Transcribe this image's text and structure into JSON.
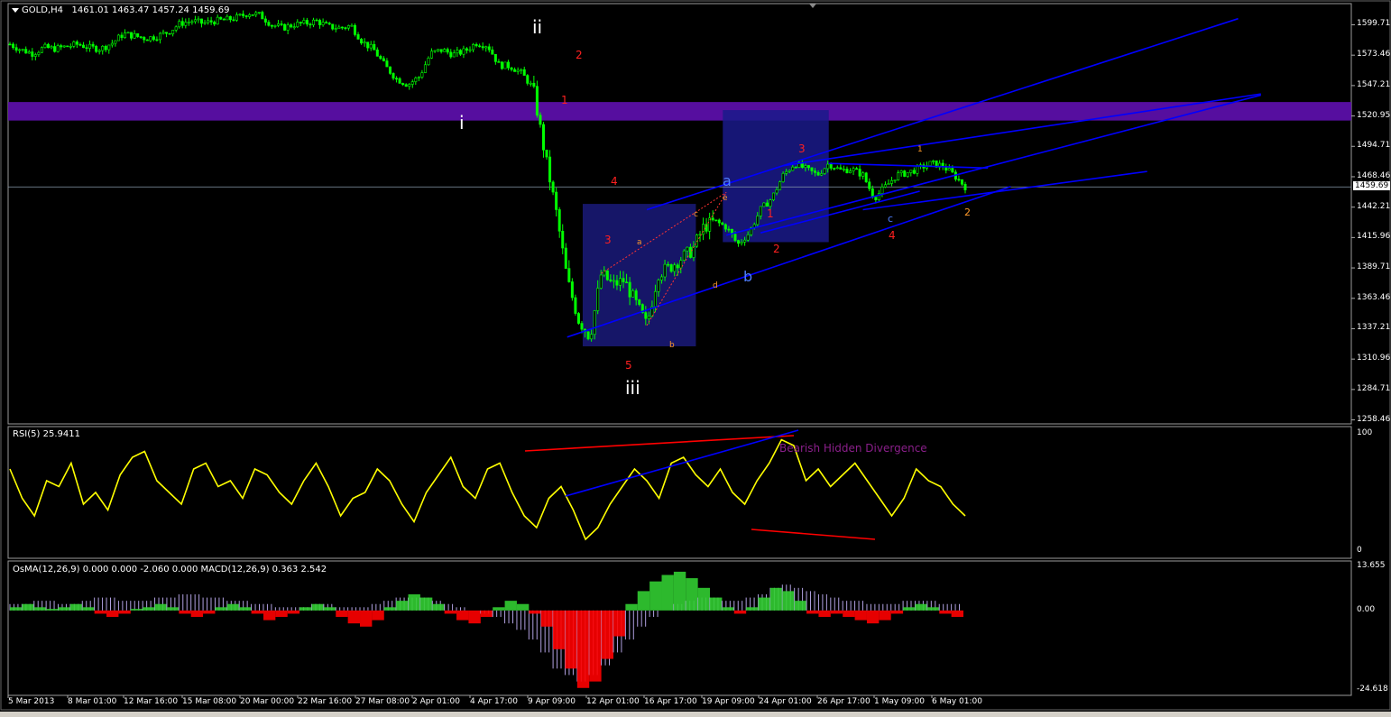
{
  "header": {
    "symbol": "GOLD,H4",
    "ohlc": "1461.01 1463.47 1457.24 1459.69"
  },
  "colors": {
    "candle_up": "#00ff00",
    "candle_down": "#00ff00",
    "rsi_line": "#ffff00",
    "zone": "#5b0fa8",
    "trend_lines": "#0000ff",
    "divergence": "#ff0000",
    "osma_pos": "#32cd32",
    "osma_neg": "#ff0000",
    "macd_bars": "#b0a0e0"
  },
  "chart_data": [
    {
      "type": "candlestick",
      "title": "GOLD,H4",
      "current_price": "1459.69",
      "ylim": [
        1255,
        1618
      ],
      "y_ticks": [
        "1599.71",
        "1573.46",
        "1547.21",
        "1520.95",
        "1494.71",
        "1468.46",
        "1442.21",
        "1415.96",
        "1389.71",
        "1363.46",
        "1337.21",
        "1310.96",
        "1284.71",
        "1258.46"
      ],
      "x_ticks": [
        "5 Mar 2013",
        "8 Mar 01:00",
        "12 Mar 16:00",
        "15 Mar 08:00",
        "20 Mar 00:00",
        "22 Mar 16:00",
        "27 Mar 08:00",
        "2 Apr 01:00",
        "4 Apr 17:00",
        "9 Apr 09:00",
        "12 Apr 01:00",
        "16 Apr 17:00",
        "19 Apr 09:00",
        "24 Apr 01:00",
        "26 Apr 17:00",
        "1 May 09:00",
        "6 May 01:00"
      ],
      "close_path": [
        [
          0,
          1583
        ],
        [
          0.01,
          1578
        ],
        [
          0.02,
          1575
        ],
        [
          0.03,
          1580
        ],
        [
          0.04,
          1579
        ],
        [
          0.05,
          1581
        ],
        [
          0.06,
          1583
        ],
        [
          0.07,
          1580
        ],
        [
          0.08,
          1579
        ],
        [
          0.09,
          1584
        ],
        [
          0.1,
          1592
        ],
        [
          0.11,
          1590
        ],
        [
          0.12,
          1588
        ],
        [
          0.13,
          1590
        ],
        [
          0.14,
          1594
        ],
        [
          0.15,
          1601
        ],
        [
          0.16,
          1603
        ],
        [
          0.17,
          1601
        ],
        [
          0.18,
          1603
        ],
        [
          0.19,
          1604
        ],
        [
          0.2,
          1606
        ],
        [
          0.21,
          1610
        ],
        [
          0.22,
          1608
        ],
        [
          0.23,
          1600
        ],
        [
          0.24,
          1597
        ],
        [
          0.25,
          1600
        ],
        [
          0.26,
          1601
        ],
        [
          0.27,
          1603
        ],
        [
          0.28,
          1598
        ],
        [
          0.29,
          1597
        ],
        [
          0.3,
          1599
        ],
        [
          0.31,
          1585
        ],
        [
          0.32,
          1578
        ],
        [
          0.33,
          1564
        ],
        [
          0.34,
          1553
        ],
        [
          0.35,
          1548
        ],
        [
          0.36,
          1555
        ],
        [
          0.37,
          1575
        ],
        [
          0.38,
          1578
        ],
        [
          0.39,
          1574
        ],
        [
          0.4,
          1577
        ],
        [
          0.41,
          1584
        ],
        [
          0.42,
          1582
        ],
        [
          0.43,
          1565
        ],
        [
          0.44,
          1564
        ],
        [
          0.45,
          1558
        ],
        [
          0.46,
          1545
        ],
        [
          0.47,
          1490
        ],
        [
          0.48,
          1440
        ],
        [
          0.49,
          1380
        ],
        [
          0.5,
          1345
        ],
        [
          0.51,
          1330
        ],
        [
          0.52,
          1385
        ],
        [
          0.53,
          1375
        ],
        [
          0.54,
          1379
        ],
        [
          0.55,
          1360
        ],
        [
          0.56,
          1340
        ],
        [
          0.57,
          1385
        ],
        [
          0.58,
          1390
        ],
        [
          0.59,
          1398
        ],
        [
          0.6,
          1405
        ],
        [
          0.61,
          1425
        ],
        [
          0.62,
          1430
        ],
        [
          0.63,
          1425
        ],
        [
          0.64,
          1410
        ],
        [
          0.65,
          1420
        ],
        [
          0.66,
          1440
        ],
        [
          0.67,
          1450
        ],
        [
          0.68,
          1470
        ],
        [
          0.69,
          1480
        ],
        [
          0.7,
          1475
        ],
        [
          0.71,
          1470
        ],
        [
          0.72,
          1480
        ],
        [
          0.73,
          1474
        ],
        [
          0.74,
          1475
        ],
        [
          0.75,
          1470
        ],
        [
          0.76,
          1450
        ],
        [
          0.77,
          1460
        ],
        [
          0.78,
          1470
        ],
        [
          0.79,
          1472
        ],
        [
          0.8,
          1476
        ],
        [
          0.81,
          1480
        ],
        [
          0.82,
          1478
        ],
        [
          0.83,
          1470
        ],
        [
          0.84,
          1460
        ]
      ]
    },
    {
      "type": "line",
      "title": "RSI(5) 25.9411",
      "ylim": [
        0,
        100
      ],
      "y_ticks": [
        "100",
        "0"
      ],
      "annotation": "Bearish Hidden Divergence",
      "values": [
        70,
        45,
        30,
        60,
        55,
        75,
        40,
        50,
        35,
        65,
        80,
        85,
        60,
        50,
        40,
        70,
        75,
        55,
        60,
        45,
        70,
        65,
        50,
        40,
        60,
        75,
        55,
        30,
        45,
        50,
        70,
        60,
        40,
        25,
        50,
        65,
        80,
        55,
        45,
        70,
        75,
        50,
        30,
        20,
        45,
        55,
        35,
        10,
        20,
        40,
        55,
        70,
        60,
        45,
        75,
        80,
        65,
        55,
        70,
        50,
        40,
        60,
        75,
        95,
        90,
        60,
        70,
        55,
        65,
        75,
        60,
        45,
        30,
        45,
        70,
        60,
        55,
        40,
        30
      ]
    },
    {
      "type": "bar",
      "title": "OsMA(12,26,9) 0.000 0.000 -2.060 0.000  MACD(12,26,9) 0.363 2.542",
      "ylim": [
        -24.618,
        13.655
      ],
      "y_ticks": [
        "13.655",
        "0.00",
        "-24.618"
      ],
      "osma": [
        1,
        2,
        1,
        0.5,
        1,
        2,
        1,
        -1,
        -2,
        -1,
        0.5,
        1,
        2,
        1,
        -1,
        -2,
        -1,
        1,
        2,
        1,
        -1,
        -3,
        -2,
        -1,
        1,
        2,
        1,
        -2,
        -4,
        -5,
        -3,
        1,
        3,
        5,
        4,
        2,
        -1,
        -3,
        -4,
        -2,
        1,
        3,
        2,
        -1,
        -5,
        -12,
        -18,
        -24,
        -22,
        -15,
        -8,
        2,
        6,
        9,
        11,
        12,
        10,
        7,
        4,
        1,
        -1,
        1,
        4,
        7,
        6,
        3,
        -1,
        -2,
        -1,
        -2,
        -3,
        -4,
        -3,
        -1,
        1,
        2,
        1,
        -1,
        -2
      ],
      "macd": [
        2,
        2,
        3,
        3,
        2,
        2,
        3,
        4,
        4,
        3,
        3,
        3,
        4,
        4,
        5,
        5,
        4,
        4,
        3,
        3,
        2,
        2,
        1,
        1,
        1,
        2,
        2,
        1,
        1,
        1,
        2,
        3,
        4,
        4,
        4,
        3,
        2,
        1,
        0,
        -1,
        -2,
        -4,
        -6,
        -9,
        -13,
        -18,
        -20,
        -22,
        -20,
        -17,
        -13,
        -9,
        -5,
        -2,
        0,
        2,
        3,
        4,
        4,
        3,
        3,
        4,
        5,
        7,
        8,
        7,
        6,
        5,
        4,
        3,
        3,
        2,
        2,
        2,
        3,
        3,
        3,
        2,
        2
      ]
    }
  ],
  "wave_labels": [
    {
      "text": "ii",
      "color": "#ffffff"
    },
    {
      "text": "i",
      "color": "#ffffff"
    },
    {
      "text": "iii",
      "color": "#ffffff"
    },
    {
      "text": "2",
      "color": "#ff2020"
    },
    {
      "text": "1",
      "color": "#ff2020"
    },
    {
      "text": "4",
      "color": "#ff2020"
    },
    {
      "text": "3",
      "color": "#ff2020"
    },
    {
      "text": "5",
      "color": "#ff2020"
    },
    {
      "text": "a",
      "color": "#4f7fff"
    },
    {
      "text": "b",
      "color": "#4f7fff"
    },
    {
      "text": "3",
      "color": "#ff2020"
    },
    {
      "text": "1",
      "color": "#ff2020"
    },
    {
      "text": "2",
      "color": "#ff2020"
    },
    {
      "text": "4",
      "color": "#ff2020"
    },
    {
      "text": "1",
      "color": "#ff9a2a"
    },
    {
      "text": "2",
      "color": "#ff9a2a"
    },
    {
      "text": "a",
      "color": "#ff9a2a"
    },
    {
      "text": "b",
      "color": "#ff9a2a"
    },
    {
      "text": "c",
      "color": "#ff9a2a"
    },
    {
      "text": "d",
      "color": "#ff9a2a"
    },
    {
      "text": "e",
      "color": "#ff9a2a"
    },
    {
      "text": "c",
      "color": "#4f7fff"
    }
  ]
}
